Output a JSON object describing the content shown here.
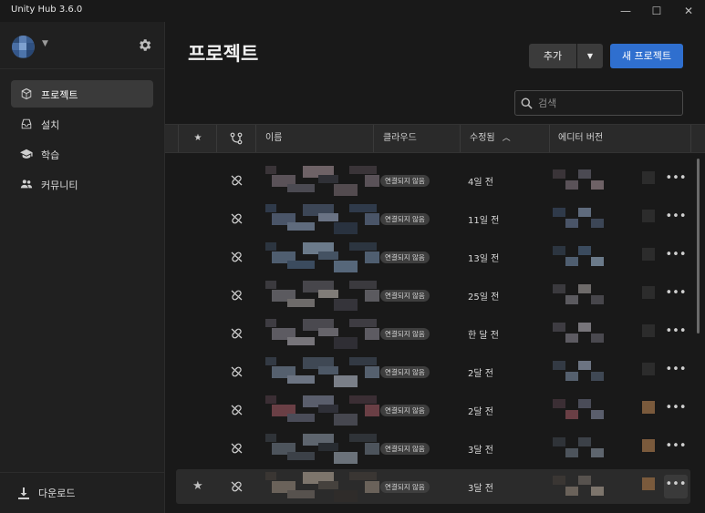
{
  "window": {
    "title": "Unity Hub 3.6.0",
    "minimize": "—",
    "maximize": "☐",
    "close": "✕"
  },
  "sidebar": {
    "items": [
      {
        "label": "프로젝트",
        "icon": "cube-icon",
        "active": true
      },
      {
        "label": "설치",
        "icon": "install-icon",
        "active": false
      },
      {
        "label": "학습",
        "icon": "graduation-cap-icon",
        "active": false
      },
      {
        "label": "커뮤니티",
        "icon": "people-icon",
        "active": false
      }
    ],
    "downloads_label": "다운로드"
  },
  "main": {
    "title": "프로젝트",
    "add_button": "추가",
    "new_project_button": "새 프로젝트",
    "search_placeholder": "검색",
    "columns": {
      "star": "★",
      "name": "이름",
      "cloud": "클라우드",
      "modified": "수정됨",
      "editor_version": "에디터 버전"
    },
    "sort": {
      "column": "modified",
      "direction": "ascending"
    },
    "rows": [
      {
        "cloud": "연결되지 않음",
        "modified": "4일 전",
        "selected": false
      },
      {
        "cloud": "연결되지 않음",
        "modified": "11일 전",
        "selected": false
      },
      {
        "cloud": "연결되지 않음",
        "modified": "13일 전",
        "selected": false
      },
      {
        "cloud": "연결되지 않음",
        "modified": "25일 전",
        "selected": false
      },
      {
        "cloud": "연결되지 않음",
        "modified": "한 달 전",
        "selected": false
      },
      {
        "cloud": "연결되지 않음",
        "modified": "2달 전",
        "selected": false
      },
      {
        "cloud": "연결되지 않음",
        "modified": "2달 전",
        "selected": false
      },
      {
        "cloud": "연결되지 않음",
        "modified": "3달 전",
        "selected": false
      },
      {
        "cloud": "연결되지 않음",
        "modified": "3달 전",
        "selected": true
      }
    ]
  },
  "colors": {
    "accent": "#2f6fcf",
    "sidebar_bg": "#202020",
    "main_bg": "#191919"
  }
}
